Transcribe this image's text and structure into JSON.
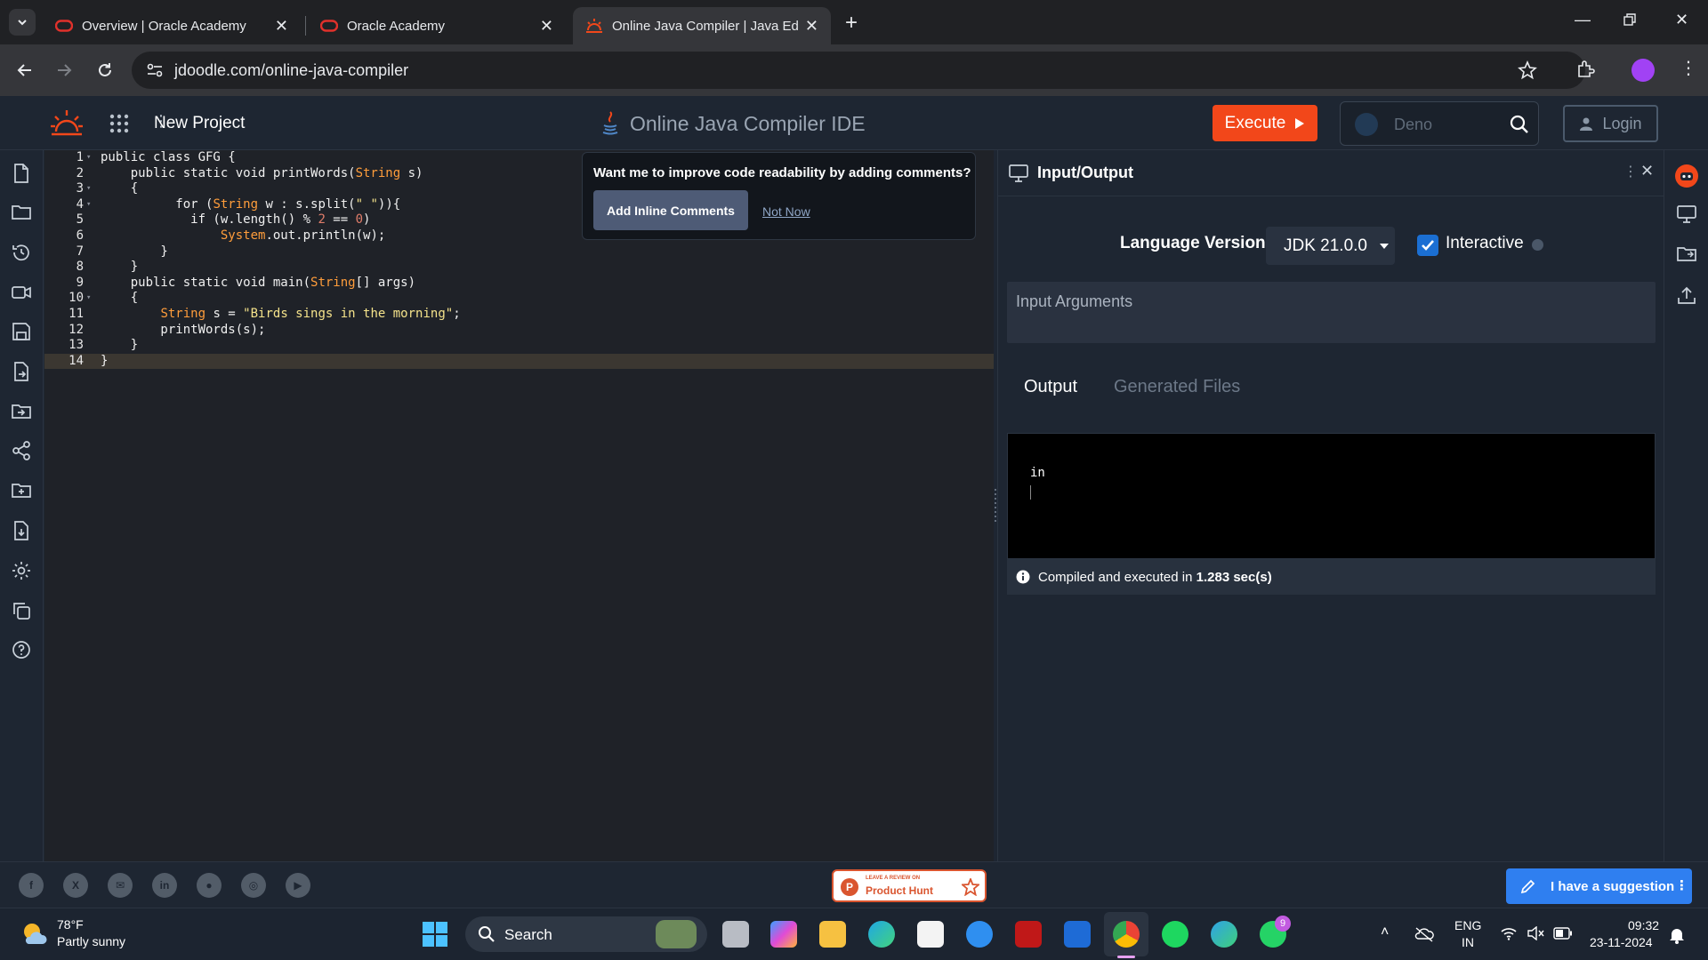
{
  "browser": {
    "tabs": [
      {
        "title": "Overview | Oracle Academy"
      },
      {
        "title": "Oracle Academy"
      },
      {
        "title": "Online Java Compiler | Java Edit"
      }
    ],
    "url": "jdoodle.com/online-java-compiler"
  },
  "header": {
    "new_project": "New Project",
    "app_title": "Online Java Compiler IDE",
    "execute_label": "Execute",
    "search_placeholder": "Deno",
    "login_label": "Login"
  },
  "editor": {
    "lines": [
      {
        "n": "1",
        "fold": true
      },
      {
        "n": "2",
        "fold": false
      },
      {
        "n": "3",
        "fold": true
      },
      {
        "n": "4",
        "fold": true
      },
      {
        "n": "5",
        "fold": false
      },
      {
        "n": "6",
        "fold": false
      },
      {
        "n": "7",
        "fold": false
      },
      {
        "n": "8",
        "fold": false
      },
      {
        "n": "9",
        "fold": false
      },
      {
        "n": "10",
        "fold": true
      },
      {
        "n": "11",
        "fold": false
      },
      {
        "n": "12",
        "fold": false
      },
      {
        "n": "13",
        "fold": false
      },
      {
        "n": "14",
        "fold": false
      }
    ],
    "active_line": 14
  },
  "popup": {
    "question": "Want me to improve code readability by adding comments?",
    "primary": "Add Inline Comments",
    "secondary": "Not Now"
  },
  "io": {
    "title": "Input/Output",
    "language_label": "Language Version:",
    "language_value": "JDK 21.0.0",
    "interactive_label": "Interactive",
    "interactive_checked": true,
    "input_placeholder": "Input Arguments",
    "tab_output": "Output",
    "tab_generated": "Generated Files",
    "output_text": "in",
    "status_prefix": "Compiled and executed in ",
    "status_time": "1.283 sec(s)"
  },
  "footer": {
    "product_hunt_small": "LEAVE A REVIEW ON",
    "product_hunt_big": "Product Hunt",
    "suggestion": "I have a suggestion"
  },
  "taskbar": {
    "temp": "78°F",
    "weather": "Partly sunny",
    "search": "Search",
    "lang1": "ENG",
    "lang2": "IN",
    "time": "09:32",
    "date": "23-11-2024",
    "whatsapp_badge": "9"
  },
  "colors": {
    "accent": "#f2471a",
    "link": "#2f7ff0",
    "checkbox": "#1b6fd3"
  }
}
